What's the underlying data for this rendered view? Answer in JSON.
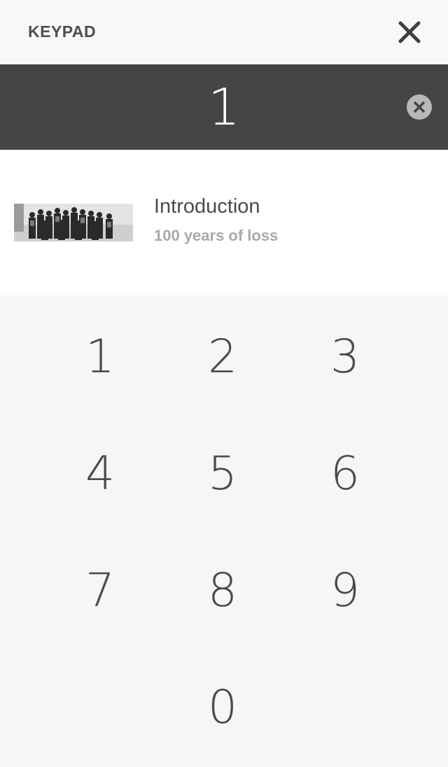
{
  "header": {
    "title": "KEYPAD",
    "close_icon": "close-icon"
  },
  "display": {
    "value": "1",
    "clear_icon": "clear-circle-icon"
  },
  "result": {
    "thumbnail": "group-photo-thumbnail",
    "title": "Introduction",
    "subtitle": "100 years of loss"
  },
  "keypad": {
    "keys": [
      "1",
      "2",
      "3",
      "4",
      "5",
      "6",
      "7",
      "8",
      "9",
      "0"
    ]
  },
  "colors": {
    "header_bg": "#f8f8f8",
    "display_bg": "#454545",
    "result_bg": "#ffffff",
    "keypad_bg": "#f6f6f6",
    "text": "#4a4a4a",
    "subtitle": "#a9a9a9"
  }
}
